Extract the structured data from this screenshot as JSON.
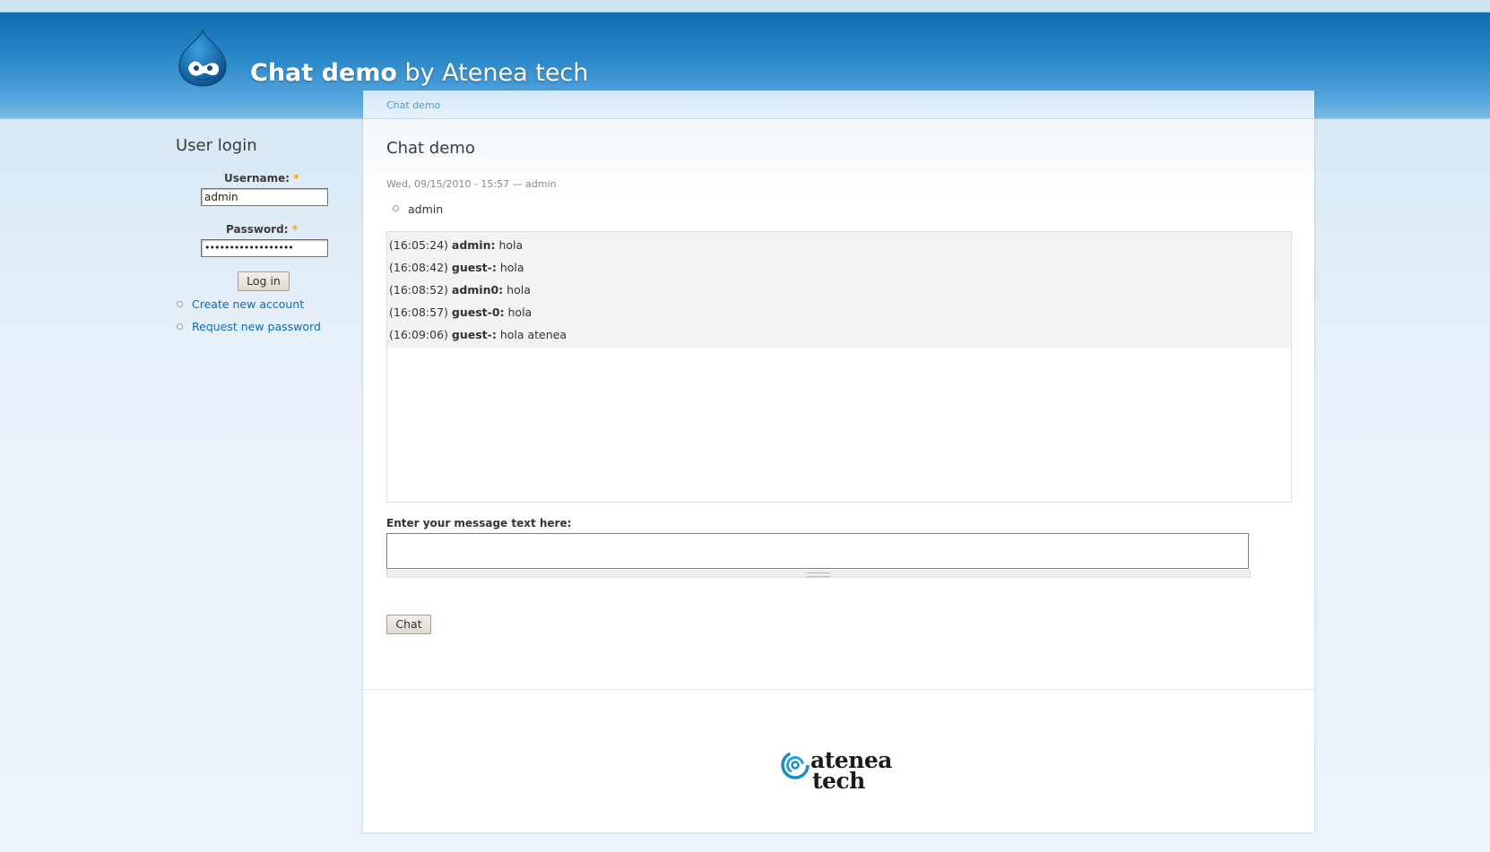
{
  "site": {
    "title_bold": "Chat demo",
    "title_rest": "by Atenea tech"
  },
  "sidebar": {
    "title": "User login",
    "username_label": "Username:",
    "username_value": "admin",
    "password_label": "Password:",
    "password_value": "••••••••••••••••••",
    "required_marker": "*",
    "login_button": "Log in",
    "links": [
      {
        "label": "Create new account"
      },
      {
        "label": "Request new password"
      }
    ]
  },
  "main": {
    "breadcrumb": "Chat demo",
    "page_title": "Chat demo",
    "submitted": "Wed, 09/15/2010 - 15:57 — admin",
    "participants": [
      "admin"
    ],
    "messages": [
      {
        "time": "(16:05:24)",
        "user": "admin:",
        "text": "hola"
      },
      {
        "time": "(16:08:42)",
        "user": "guest-:",
        "text": "hola"
      },
      {
        "time": "(16:08:52)",
        "user": "admin0:",
        "text": "hola"
      },
      {
        "time": "(16:08:57)",
        "user": "guest-0:",
        "text": "hola"
      },
      {
        "time": "(16:09:06)",
        "user": "guest-:",
        "text": "hola atenea"
      }
    ],
    "message_label": "Enter your message text here:",
    "message_value": "",
    "chat_button": "Chat"
  },
  "footer": {
    "logo_line1": "atenea",
    "logo_line2": "tech"
  },
  "colors": {
    "header_blue": "#1f7cc0",
    "link_blue": "#0d6db6",
    "required_orange": "#f2a114"
  }
}
